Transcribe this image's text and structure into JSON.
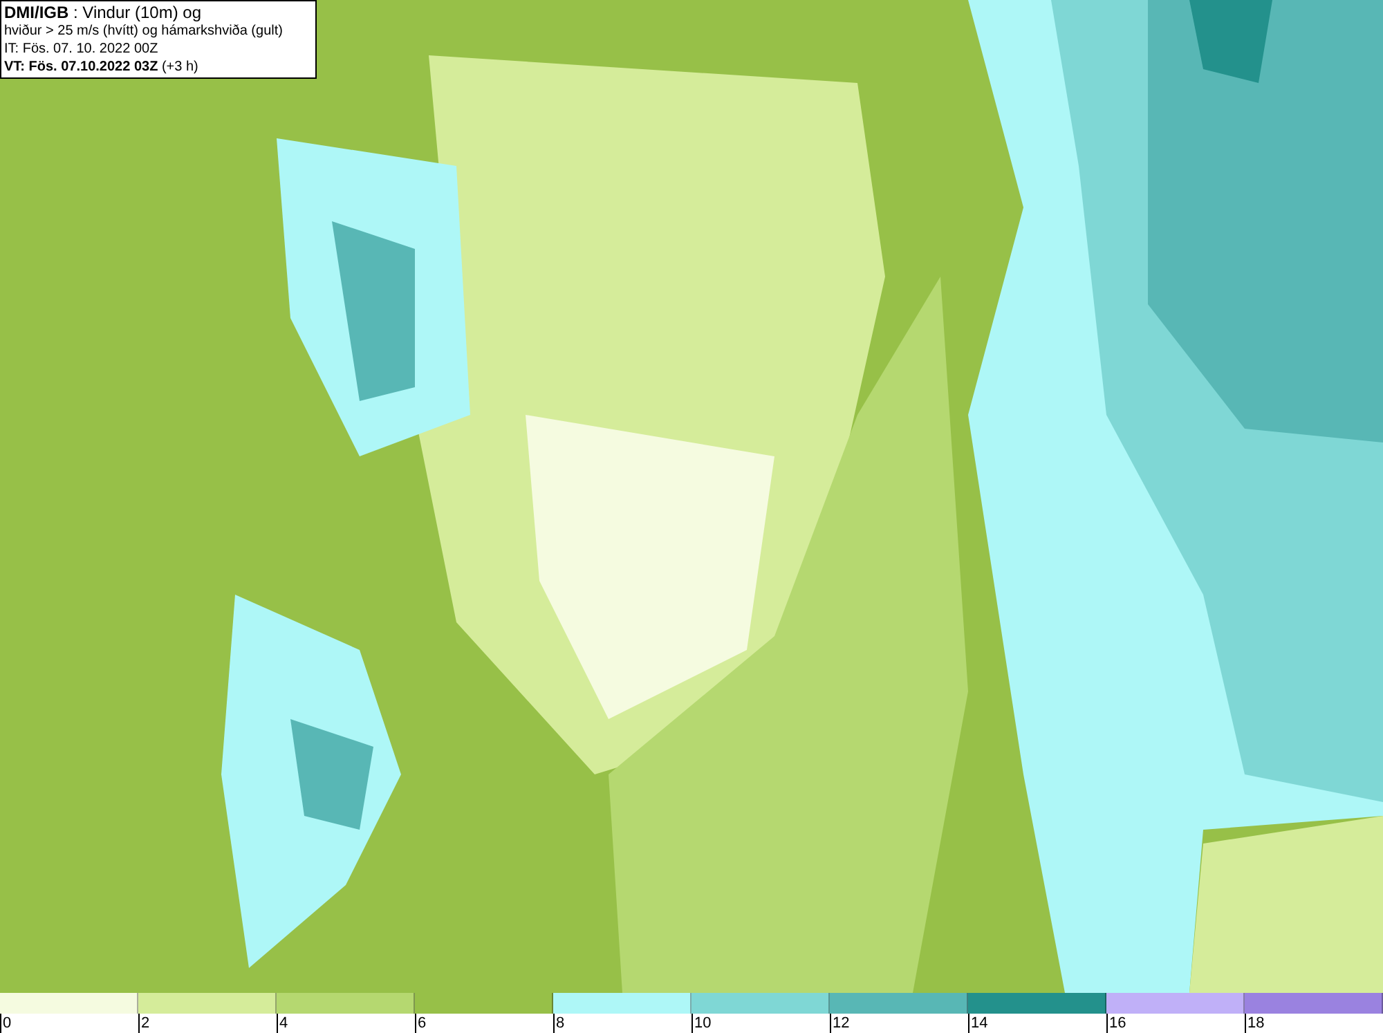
{
  "title_box": {
    "lines": [
      "**DMI/IGB** : Vindur (10m) og",
      "hviður > 25 m/s (hvítt) og hámarkshviða (gult)",
      "IT: Fös. 07. 10. 2022 00Z",
      "**VT: Fös. 07.10.2022 03Z** (+3 h)"
    ]
  },
  "legend": {
    "segments": [
      {
        "color": "#f5fbe0"
      },
      {
        "color": "#d5ec9a"
      },
      {
        "color": "#b5d870"
      },
      {
        "color": "#97c048"
      },
      {
        "color": "#aef7f7"
      },
      {
        "color": "#7fd7d5"
      },
      {
        "color": "#58b7b5"
      },
      {
        "color": "#23918c"
      },
      {
        "color": "#c0b0f8"
      },
      {
        "color": "#9a82e0"
      }
    ],
    "ticks": [
      "0",
      "2",
      "4",
      "6",
      "8",
      "10",
      "12",
      "14",
      "16",
      "18"
    ]
  }
}
